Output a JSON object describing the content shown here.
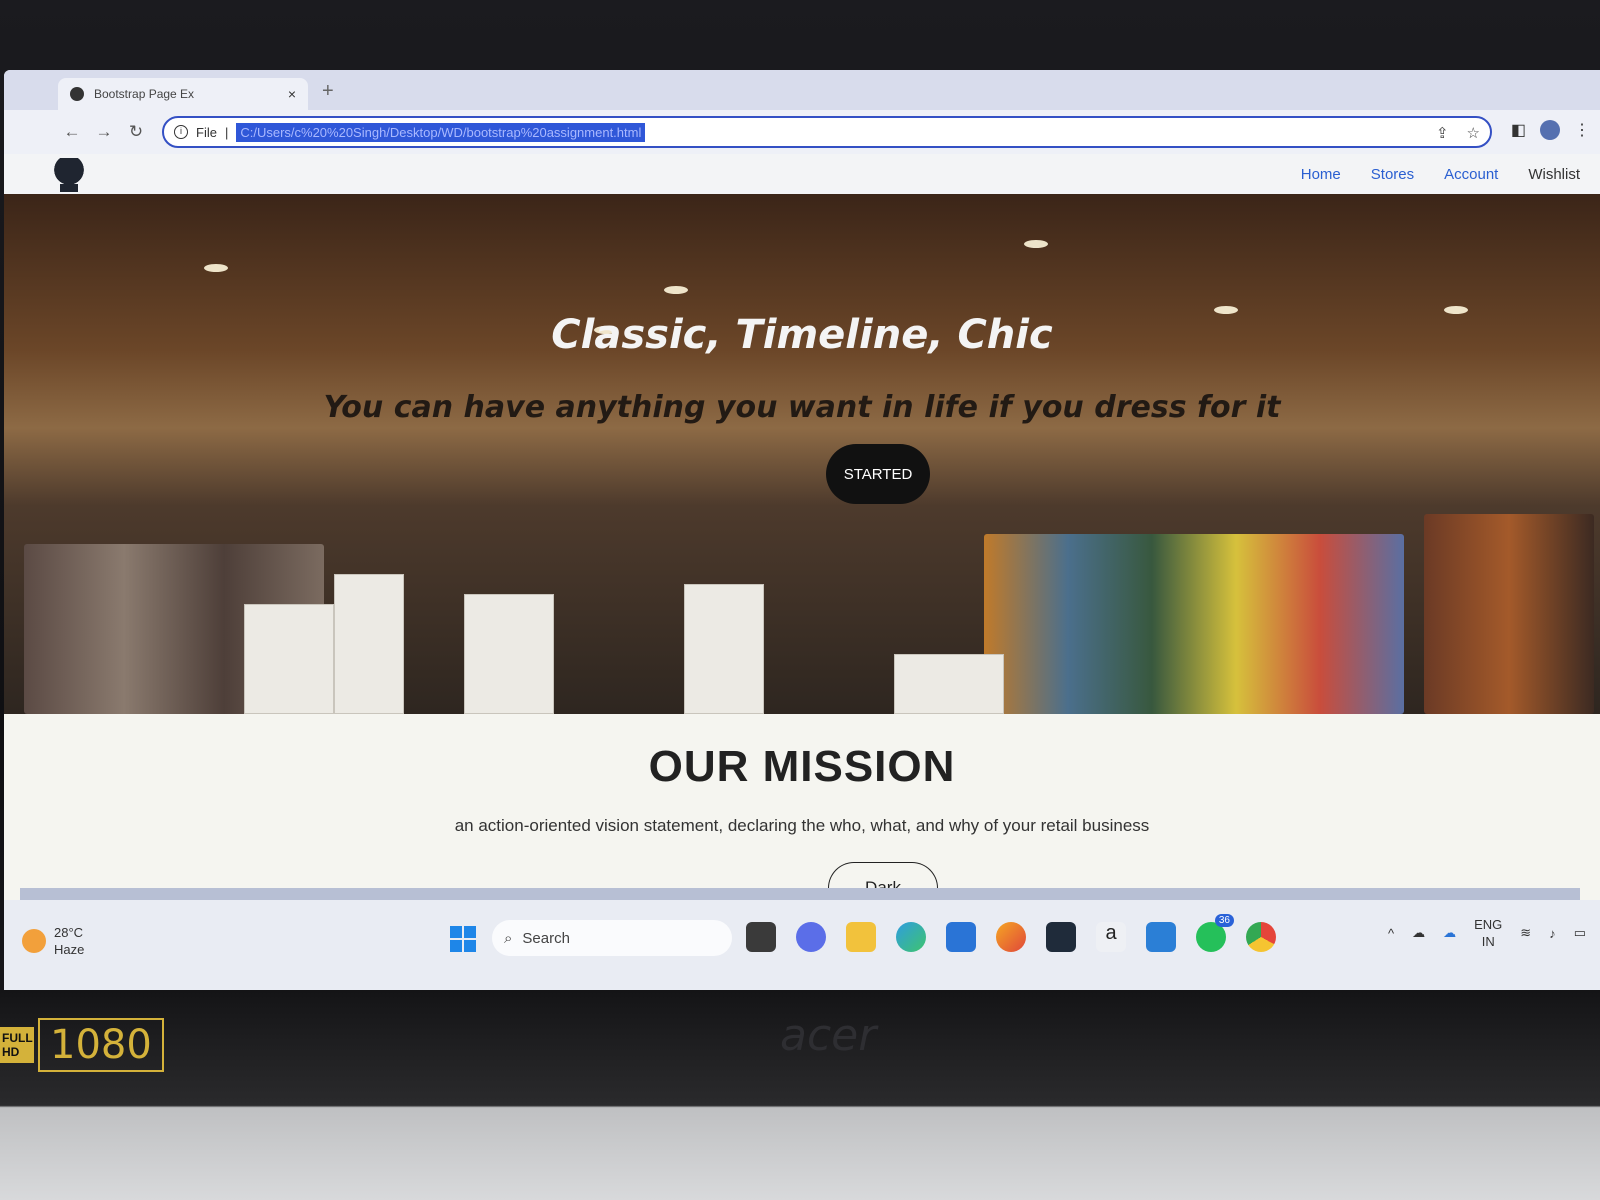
{
  "browser": {
    "tab_title": "Bootstrap Page Ex",
    "tab_close": "×",
    "new_tab": "+",
    "file_label": "File",
    "url": "C:/Users/c%20%20Singh/Desktop/WD/bootstrap%20assignment.html"
  },
  "site": {
    "nav": [
      {
        "label": "Home"
      },
      {
        "label": "Stores"
      },
      {
        "label": "Account"
      },
      {
        "label": "Wishlist"
      }
    ],
    "hero": {
      "title": "Classic, Timeline, Chic",
      "subtitle": "You can have anything you want in life if you dress for it",
      "button": "STARTED"
    },
    "mission": {
      "heading": "OUR MISSION",
      "text": "an action-oriented vision statement, declaring the who, what, and why of your retail business",
      "button": "Dark"
    }
  },
  "taskbar": {
    "weather_temp": "28°C",
    "weather_desc": "Haze",
    "search_placeholder": "Search",
    "whatsapp_badge": "36",
    "lang_top": "ENG",
    "lang_bottom": "IN"
  },
  "laptop": {
    "brand": "acer",
    "badge_top": "FULL HD",
    "badge_res": "1080"
  }
}
